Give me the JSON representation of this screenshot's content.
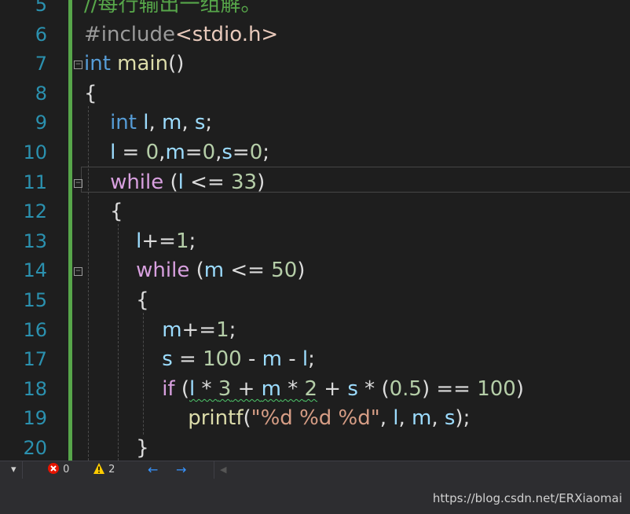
{
  "editor": {
    "lines": [
      {
        "num": "5",
        "tokens": [
          {
            "t": "//每行输出一组解。",
            "c": "cmt"
          }
        ]
      },
      {
        "num": "6",
        "tokens": [
          {
            "t": "#include",
            "c": "pp"
          },
          {
            "t": "<stdio.h>",
            "c": "inc"
          }
        ]
      },
      {
        "num": "7",
        "tokens": [
          {
            "t": "int",
            "c": "kw"
          },
          {
            "t": " "
          },
          {
            "t": "main",
            "c": "fn"
          },
          {
            "t": "()"
          }
        ]
      },
      {
        "num": "8",
        "tokens": [
          {
            "t": "{"
          }
        ]
      },
      {
        "num": "9",
        "tokens": [
          {
            "t": "    "
          },
          {
            "t": "int",
            "c": "kw"
          },
          {
            "t": " "
          },
          {
            "t": "l",
            "c": "var"
          },
          {
            "t": ", "
          },
          {
            "t": "m",
            "c": "var"
          },
          {
            "t": ", "
          },
          {
            "t": "s",
            "c": "var"
          },
          {
            "t": ";"
          }
        ]
      },
      {
        "num": "10",
        "tokens": [
          {
            "t": "    "
          },
          {
            "t": "l",
            "c": "var"
          },
          {
            "t": " = "
          },
          {
            "t": "0",
            "c": "num"
          },
          {
            "t": ","
          },
          {
            "t": "m",
            "c": "var"
          },
          {
            "t": "="
          },
          {
            "t": "0",
            "c": "num"
          },
          {
            "t": ","
          },
          {
            "t": "s",
            "c": "var"
          },
          {
            "t": "="
          },
          {
            "t": "0",
            "c": "num"
          },
          {
            "t": ";"
          }
        ]
      },
      {
        "num": "11",
        "tokens": [
          {
            "t": "    "
          },
          {
            "t": "while",
            "c": "ctl"
          },
          {
            "t": " ("
          },
          {
            "t": "l",
            "c": "var"
          },
          {
            "t": " <= "
          },
          {
            "t": "33",
            "c": "num"
          },
          {
            "t": ")"
          }
        ]
      },
      {
        "num": "12",
        "tokens": [
          {
            "t": "    {"
          }
        ]
      },
      {
        "num": "13",
        "tokens": [
          {
            "t": "        "
          },
          {
            "t": "l",
            "c": "var"
          },
          {
            "t": "+="
          },
          {
            "t": "1",
            "c": "num"
          },
          {
            "t": ";"
          }
        ]
      },
      {
        "num": "14",
        "tokens": [
          {
            "t": "        "
          },
          {
            "t": "while",
            "c": "ctl"
          },
          {
            "t": " ("
          },
          {
            "t": "m",
            "c": "var"
          },
          {
            "t": " <= "
          },
          {
            "t": "50",
            "c": "num"
          },
          {
            "t": ")"
          }
        ]
      },
      {
        "num": "15",
        "tokens": [
          {
            "t": "        {"
          }
        ]
      },
      {
        "num": "16",
        "tokens": [
          {
            "t": "            "
          },
          {
            "t": "m",
            "c": "var"
          },
          {
            "t": "+="
          },
          {
            "t": "1",
            "c": "num"
          },
          {
            "t": ";"
          }
        ]
      },
      {
        "num": "17",
        "tokens": [
          {
            "t": "            "
          },
          {
            "t": "s",
            "c": "var"
          },
          {
            "t": " = "
          },
          {
            "t": "100",
            "c": "num"
          },
          {
            "t": " - "
          },
          {
            "t": "m",
            "c": "var"
          },
          {
            "t": " - "
          },
          {
            "t": "l",
            "c": "var"
          },
          {
            "t": ";"
          }
        ]
      },
      {
        "num": "18",
        "tokens": [
          {
            "t": "            "
          },
          {
            "t": "if",
            "c": "ctl"
          },
          {
            "t": " ("
          },
          {
            "t": "l",
            "c": "var squig"
          },
          {
            "t": " * ",
            "c": "squig"
          },
          {
            "t": "3",
            "c": "num squig"
          },
          {
            "t": " + ",
            "c": "squig"
          },
          {
            "t": "m",
            "c": "var squig"
          },
          {
            "t": " * ",
            "c": "squig"
          },
          {
            "t": "2",
            "c": "num squig"
          },
          {
            "t": " + "
          },
          {
            "t": "s",
            "c": "var"
          },
          {
            "t": " * ("
          },
          {
            "t": "0.5",
            "c": "num"
          },
          {
            "t": ") == "
          },
          {
            "t": "100",
            "c": "num"
          },
          {
            "t": ")"
          }
        ]
      },
      {
        "num": "19",
        "tokens": [
          {
            "t": "                "
          },
          {
            "t": "printf",
            "c": "fn"
          },
          {
            "t": "("
          },
          {
            "t": "\"%d %d %d\"",
            "c": "str"
          },
          {
            "t": ", "
          },
          {
            "t": "l",
            "c": "var"
          },
          {
            "t": ", "
          },
          {
            "t": "m",
            "c": "var"
          },
          {
            "t": ", "
          },
          {
            "t": "s",
            "c": "var"
          },
          {
            "t": ");"
          }
        ]
      },
      {
        "num": "20",
        "tokens": [
          {
            "t": "        }"
          }
        ]
      }
    ],
    "fold_markers": [
      "7",
      "11",
      "14"
    ],
    "current_line": "11"
  },
  "statusbar": {
    "errors": "0",
    "warnings": "2"
  },
  "watermark": "https://blog.csdn.net/ERXiaomai"
}
